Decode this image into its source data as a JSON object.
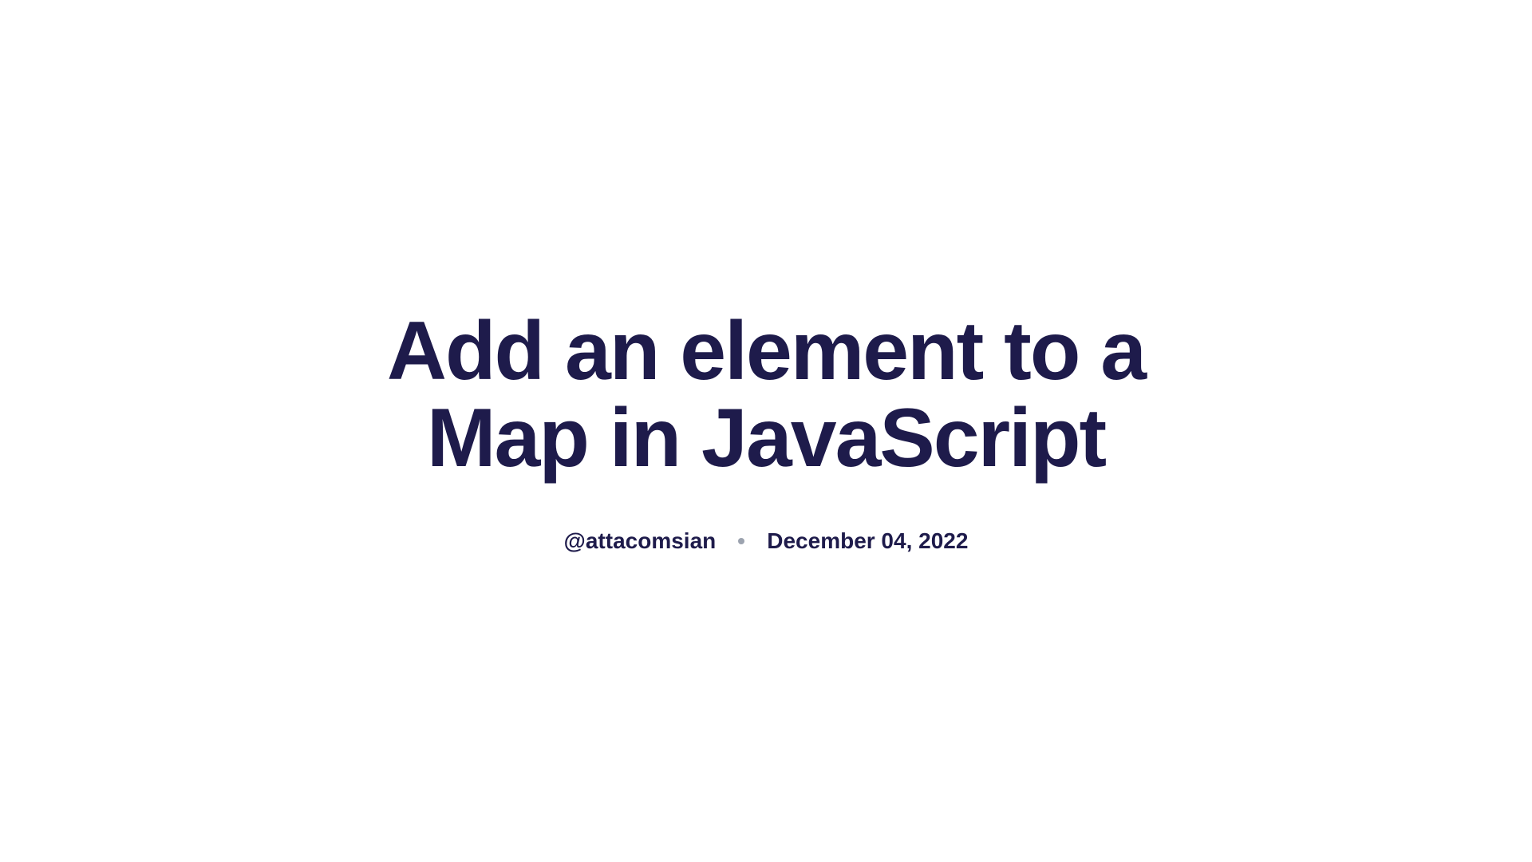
{
  "title": "Add an element to a Map in JavaScript",
  "author": "@attacomsian",
  "date": "December 04, 2022"
}
